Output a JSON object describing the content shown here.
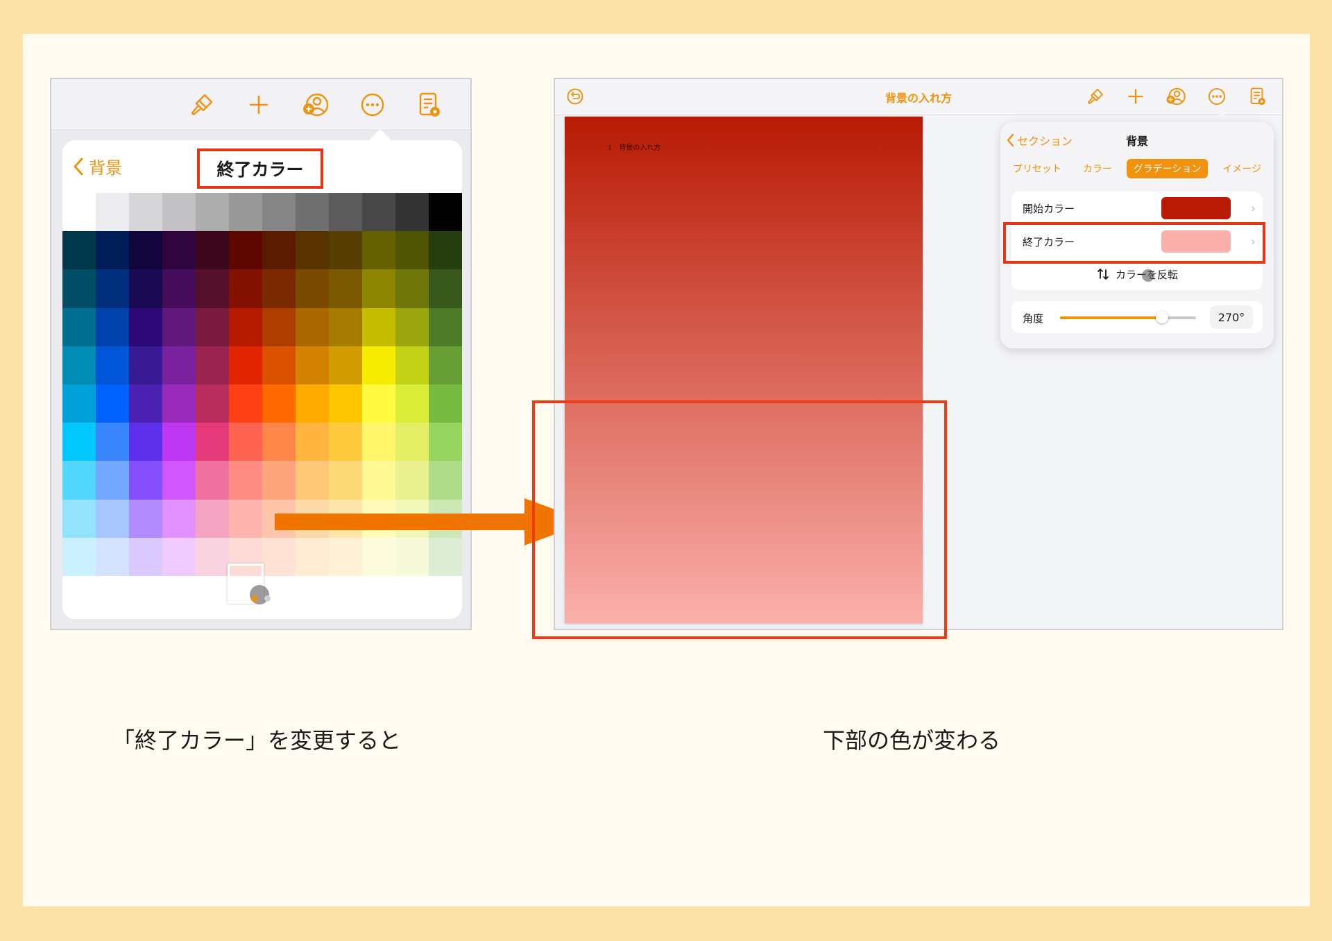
{
  "left": {
    "popover": {
      "back_label": "背景",
      "title": "終了カラー"
    },
    "palette": {
      "rows": [
        [
          "#ffffff",
          "#ebebf0",
          "#d6d6d8",
          "#c2c2c4",
          "#adadad",
          "#999999",
          "#858585",
          "#707070",
          "#5c5c5c",
          "#474747",
          "#333333",
          "#000000"
        ],
        [
          "#00374a",
          "#011d57",
          "#11053b",
          "#2e063d",
          "#3c071b",
          "#5c0701",
          "#5a1c00",
          "#583300",
          "#563d00",
          "#666100",
          "#4f5504",
          "#263e0f"
        ],
        [
          "#004d65",
          "#012f7b",
          "#1a0a52",
          "#450d59",
          "#551029",
          "#831100",
          "#7b2900",
          "#7a4a00",
          "#785800",
          "#8c8602",
          "#6f760a",
          "#38571a"
        ],
        [
          "#016e8f",
          "#0042a9",
          "#2c0977",
          "#61187c",
          "#791a3d",
          "#b51a00",
          "#ad3e00",
          "#a96800",
          "#a67b01",
          "#c4bc00",
          "#9ba50e",
          "#4e7a27"
        ],
        [
          "#008cb4",
          "#0056d6",
          "#371a94",
          "#7a219e",
          "#99244f",
          "#e22400",
          "#da5100",
          "#d38301",
          "#d19d01",
          "#f5ec00",
          "#c3d117",
          "#669d34"
        ],
        [
          "#00a1d8",
          "#0061fe",
          "#4d22b2",
          "#982abc",
          "#b92d5d",
          "#ff4015",
          "#ff6a00",
          "#ffab01",
          "#fdc700",
          "#fefb41",
          "#d9ec37",
          "#76bb40"
        ],
        [
          "#01c7fc",
          "#3a87fd",
          "#5e30eb",
          "#be38f3",
          "#e63b7a",
          "#fe6250",
          "#fe8648",
          "#feb43f",
          "#fecb3e",
          "#fff76b",
          "#e4ef65",
          "#96d35f"
        ],
        [
          "#52d6fc",
          "#74a7ff",
          "#864ffd",
          "#d357fe",
          "#ee719e",
          "#ff8c82",
          "#fea57d",
          "#fec777",
          "#fed977",
          "#fff994",
          "#eaf28f",
          "#b1dd8b"
        ],
        [
          "#93e3fc",
          "#a7c6ff",
          "#b18cfe",
          "#e292fe",
          "#f4a4c0",
          "#ffb5af",
          "#ffc5ab",
          "#fed9a8",
          "#fde4a8",
          "#fffbb9",
          "#f1f7b7",
          "#cde8b5"
        ],
        [
          "#cbf0ff",
          "#d3e2ff",
          "#d9c9fe",
          "#efcaff",
          "#f9d3e0",
          "#ffdbd8",
          "#ffe2d6",
          "#feecd4",
          "#fef1d5",
          "#fdfbdd",
          "#f6fadb",
          "#deeed4"
        ]
      ]
    }
  },
  "right": {
    "doc_title": "背景の入れ方",
    "page_text": "1　背景の入れ方",
    "panel": {
      "back_label": "セクション",
      "title": "背景",
      "tabs": [
        "プリセット",
        "カラー",
        "グラデーション",
        "イメージ"
      ],
      "active_tab": 2,
      "start_color_label": "開始カラー",
      "start_color": "#b81a04",
      "end_color_label": "終了カラー",
      "end_color": "#fbb0ab",
      "reverse_label": "カラーを反転",
      "angle_label": "角度",
      "angle_value": "270°",
      "angle_fraction": 0.75
    }
  },
  "captions": {
    "left": "「終了カラー」を変更すると",
    "right": "下部の色が変わる"
  },
  "colors": {
    "accent": "#f0920d",
    "highlight": "#e6361a",
    "arrow": "#ef7400"
  }
}
